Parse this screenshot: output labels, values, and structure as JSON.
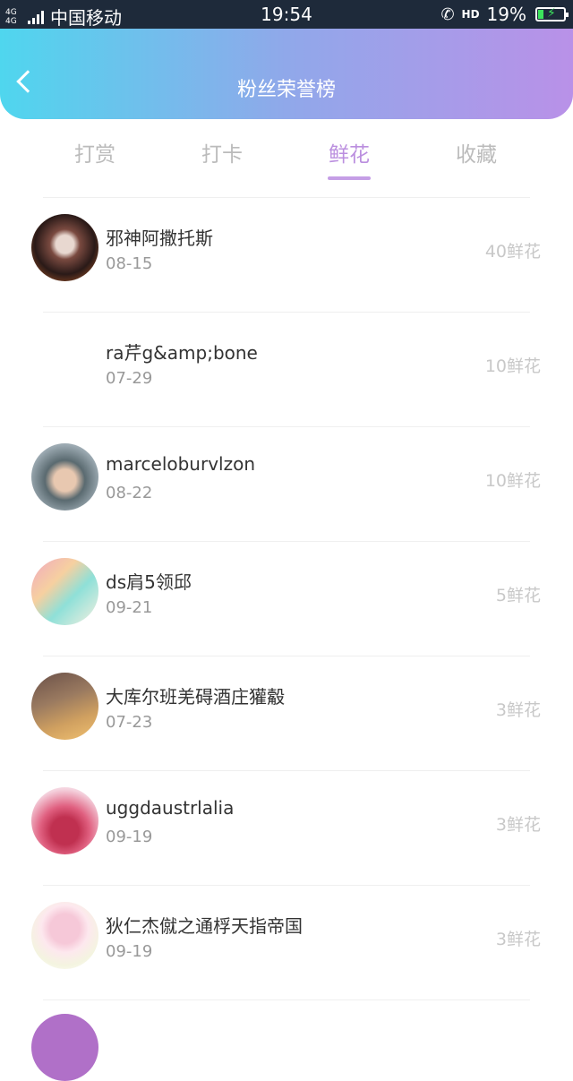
{
  "status_bar": {
    "network": "4G 4G",
    "carrier": "中国移动",
    "time": "19:54",
    "hd_label": "HD",
    "battery": "19%"
  },
  "header": {
    "title": "粉丝荣誉榜",
    "gradient": [
      "#4fd6ee",
      "#b991e8"
    ]
  },
  "tabs": [
    {
      "label": "打赏"
    },
    {
      "label": "打卡"
    },
    {
      "label": "鲜花",
      "active": true
    },
    {
      "label": "收藏"
    }
  ],
  "fans": [
    {
      "name": "邪神阿撒托斯",
      "date": "08-15",
      "count": "40鲜花"
    },
    {
      "name": "ra芹g&amp;bone",
      "date": "07-29",
      "count": "10鲜花"
    },
    {
      "name": "marceloburvlzon",
      "date": "08-22",
      "count": "10鲜花"
    },
    {
      "name": "ds肩5领邱",
      "date": "09-21",
      "count": "5鲜花"
    },
    {
      "name": "大库尔班羌碍酒庄獾觳",
      "date": "07-23",
      "count": "3鲜花"
    },
    {
      "name": "uggdaustrlalia",
      "date": "09-19",
      "count": "3鲜花"
    },
    {
      "name": "狄仁杰僦之通桴天指帝国",
      "date": "09-19",
      "count": "3鲜花"
    }
  ]
}
